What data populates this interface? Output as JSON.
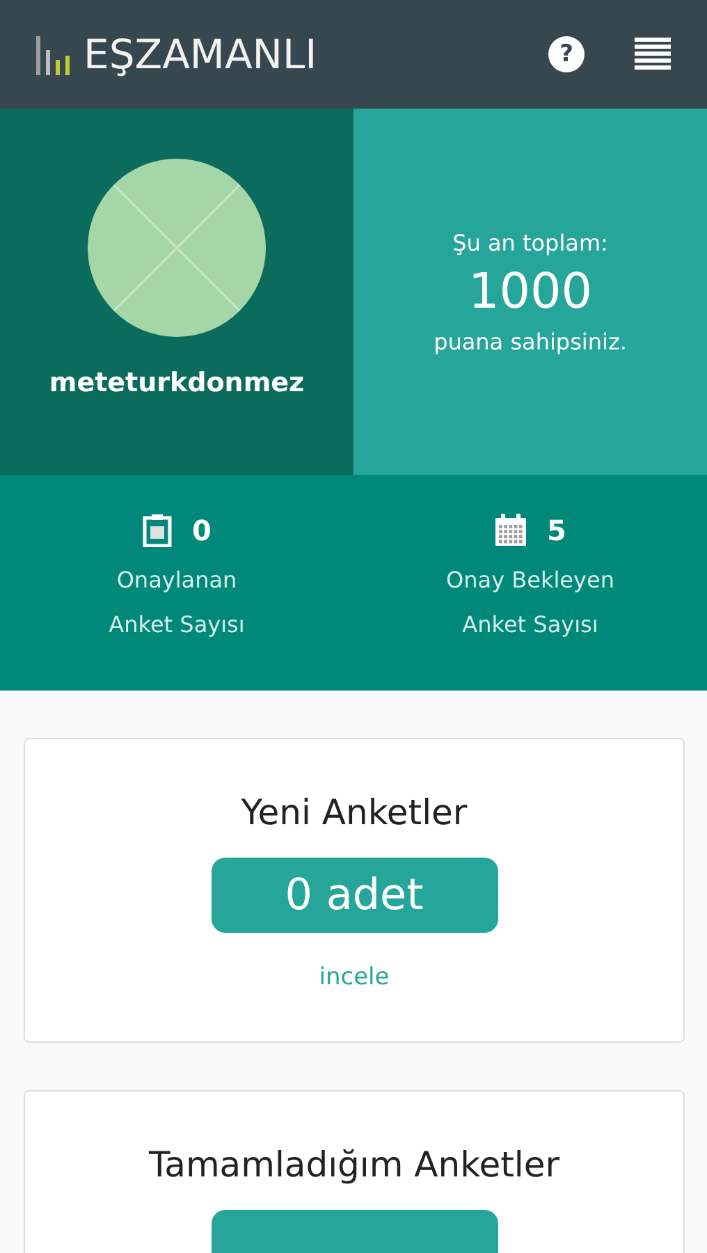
{
  "header": {
    "brand": "EŞZAMANLI",
    "help_icon": "?"
  },
  "profile": {
    "username": "meteturkdonmez"
  },
  "points": {
    "prefix": "Şu an toplam:",
    "value": "1000",
    "suffix": "puana sahipsiniz."
  },
  "stats": [
    {
      "kind": "clipboard",
      "count": "0",
      "label_lines": [
        "Onaylanan",
        "Anket Sayısı"
      ]
    },
    {
      "kind": "calendar",
      "count": "5",
      "label_lines": [
        "Onay Bekleyen",
        "Anket Sayısı"
      ]
    }
  ],
  "cards": [
    {
      "title": "Yeni Anketler",
      "button_label": "0 adet",
      "link": "incele"
    },
    {
      "title": "Tamamladığım Anketler"
    }
  ]
}
